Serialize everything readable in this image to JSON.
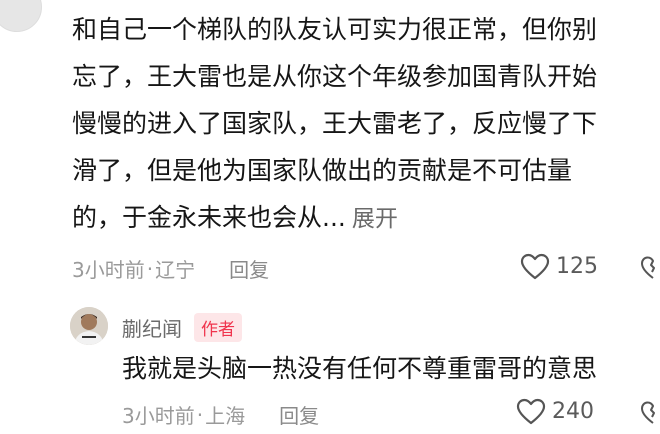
{
  "comment": {
    "lines": [
      "和自己一个梯队的队友认可实力很正常，但你别",
      "忘了，王大雷也是从你这个年级参加国青队开始",
      "慢慢的进入了国家队，王大雷老了，反应慢了下",
      "滑了，但是他为国家队做出的贡献是不可估量",
      "的，于金永未来也会从..."
    ],
    "expand_label": "展开",
    "time": "3小时前",
    "location": "辽宁",
    "separator": "·",
    "reply_label": "回复",
    "like_count": "125"
  },
  "reply": {
    "author": "蒯纪闻",
    "badge": "作者",
    "text": "我就是头脑一热没有任何不尊重雷哥的意思",
    "time": "3小时前",
    "location": "上海",
    "separator": "·",
    "reply_label": "回复",
    "like_count": "240"
  },
  "colors": {
    "badge_text": "#f0344d",
    "badge_bg": "#fde6e8",
    "meta_text": "#9a9a9a"
  }
}
